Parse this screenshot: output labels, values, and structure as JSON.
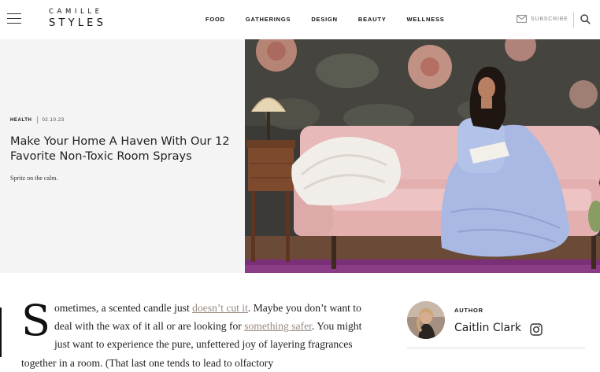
{
  "header": {
    "logo_line1": "CAMILLE",
    "logo_line2": "STYLES",
    "nav": [
      "FOOD",
      "GATHERINGS",
      "DESIGN",
      "BEAUTY",
      "WELLNESS"
    ],
    "subscribe_label": "SUBSCRIBE",
    "icons": [
      "menu-icon",
      "mail-icon",
      "search-icon"
    ]
  },
  "hero": {
    "category": "HEALTH",
    "date": "02.10.23",
    "title": "Make Your Home A Haven With Our 12 Favorite Non-Toxic Room Sprays",
    "subtitle": "Spritz on the calm."
  },
  "article": {
    "dropcap": "S",
    "text1": "ometimes, a scented candle just ",
    "link1": "doesn’t cut it",
    "text2": ". Maybe you don’t want to deal with the wax of it all or are looking for ",
    "link2": "something safer",
    "text3": ". You might just want to experience the pure, unfettered joy of layering fragrances together in a room. (That last one tends to lead to olfactory"
  },
  "author": {
    "label": "AUTHOR",
    "name": "Caitlin Clark",
    "social_icon": "instagram-icon"
  },
  "colors": {
    "accent_link": "#9a8a80",
    "hero_panel_bg": "#f4f4f5",
    "sofa_pink": "#e8b9b9",
    "rug_purple": "#7a2f78"
  }
}
